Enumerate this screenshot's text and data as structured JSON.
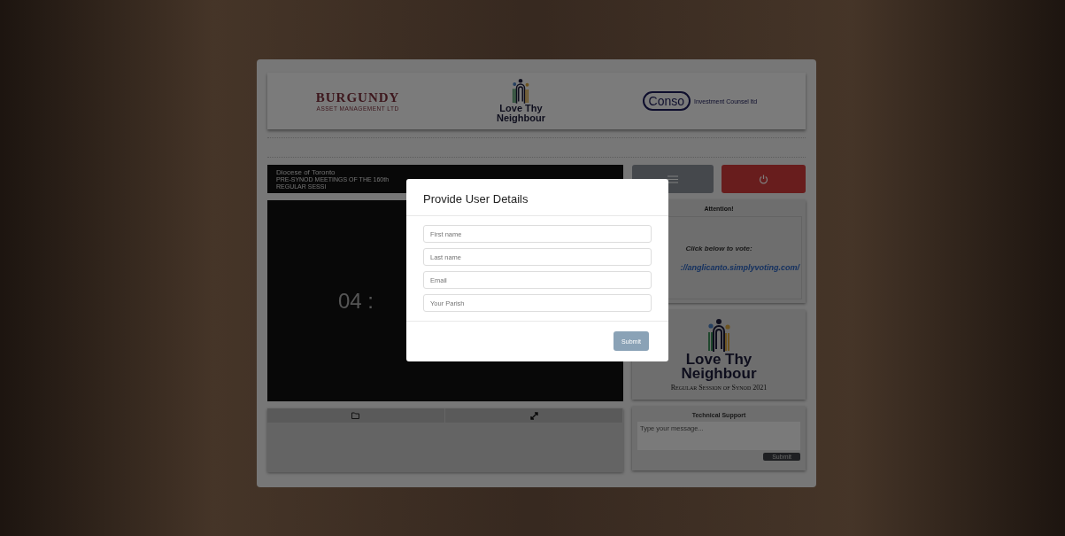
{
  "header": {
    "logos": [
      {
        "kind": "burgundy",
        "name": "BURGUNDY",
        "tagline": "ASSET MANAGEMENT LTD"
      },
      {
        "kind": "ltn",
        "line1": "Love Thy",
        "line2": "Neighbour"
      },
      {
        "kind": "conso",
        "name": "Conso",
        "tagline": "Investment Counsel ltd"
      }
    ]
  },
  "stream": {
    "title": "Diocese of Toronto",
    "subtitle": "PRE-SYNOD MEETINGS OF THE 160th REGULAR SESSI",
    "timer": "04 :"
  },
  "attention": {
    "title": "Attention!",
    "prompt": "Click below to vote:",
    "link": "://anglicanto.simplyvoting.com/"
  },
  "banner": {
    "line1": "Love Thy",
    "line2": "Neighbour",
    "caption": "Regular Session of Synod 2021"
  },
  "support": {
    "title": "Technical Support",
    "placeholder": "Type your message...",
    "button": "Submit"
  },
  "modal": {
    "title": "Provide User Details",
    "fields": [
      {
        "placeholder": "First name"
      },
      {
        "placeholder": "Last name"
      },
      {
        "placeholder": "Email"
      },
      {
        "placeholder": "Your Parish"
      }
    ],
    "button": "Submit"
  }
}
